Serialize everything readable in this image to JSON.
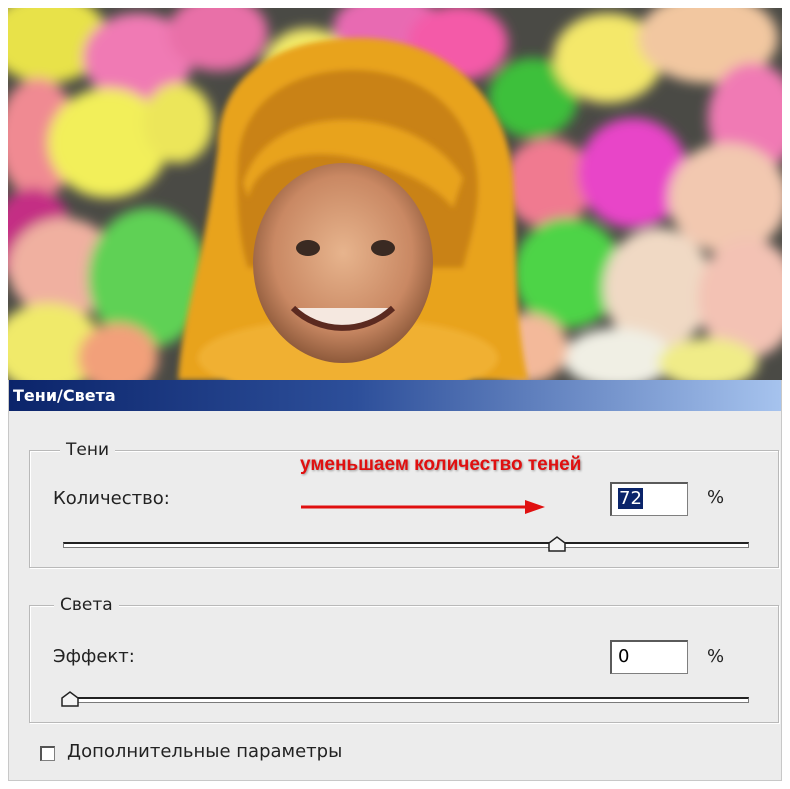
{
  "dialog": {
    "title": "Тени/Света",
    "shadows": {
      "legend": "Тени",
      "amount_label": "Количество:",
      "amount_value": "72",
      "unit": "%",
      "slider_value_percent": 72
    },
    "highlights": {
      "legend": "Света",
      "amount_label": "Эффект:",
      "amount_value": "0",
      "unit": "%",
      "slider_value_percent": 0
    },
    "more_options": {
      "label": "Дополнительные параметры",
      "checked": false
    }
  },
  "annotation": {
    "text": "уменьшаем количество теней",
    "color": "#e01010"
  },
  "colors": {
    "titlebar_start": "#0b246a",
    "titlebar_end": "#a6c3ee",
    "dialog_bg": "#ececec",
    "selection": "#0a246a"
  }
}
